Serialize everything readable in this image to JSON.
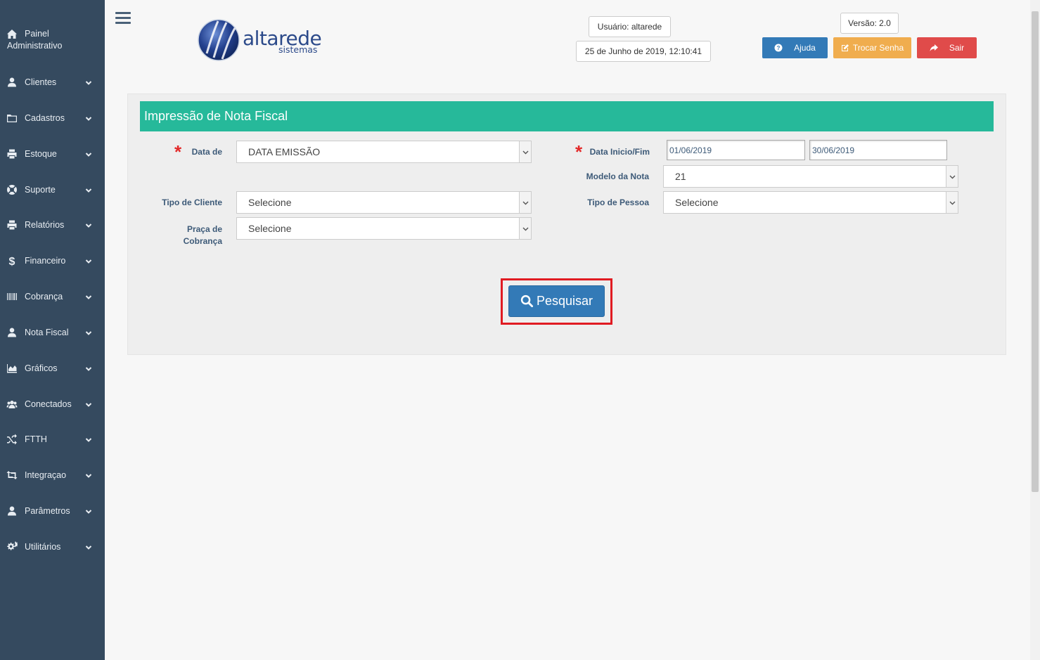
{
  "sidebar": {
    "painel_line1": "Painel",
    "painel_line2": "Administrativo",
    "items": [
      {
        "label": "Clientes",
        "icon": "user-icon"
      },
      {
        "label": "Cadastros",
        "icon": "folder-icon"
      },
      {
        "label": "Estoque",
        "icon": "print-icon"
      },
      {
        "label": "Suporte",
        "icon": "lifebuoy-icon"
      },
      {
        "label": "Relatórios",
        "icon": "print-icon"
      },
      {
        "label": "Financeiro",
        "icon": "dollar-icon"
      },
      {
        "label": "Cobrança",
        "icon": "barcode-icon"
      },
      {
        "label": "Nota Fiscal",
        "icon": "user-icon"
      },
      {
        "label": "Gráficos",
        "icon": "area-chart-icon"
      },
      {
        "label": "Conectados",
        "icon": "users-icon"
      },
      {
        "label": "FTTH",
        "icon": "random-icon"
      },
      {
        "label": "Integraçao",
        "icon": "retweet-icon"
      },
      {
        "label": "Parâmetros",
        "icon": "user-icon"
      },
      {
        "label": "Utilitários",
        "icon": "cogs-icon"
      }
    ]
  },
  "header": {
    "logo_text": "altarede",
    "logo_sub": "sistemas",
    "usuario": "Usuário: altarede",
    "datetime": "25 de Junho de 2019, 12:10:41",
    "versao": "Versão: 2.0",
    "btn_ajuda": "Ajuda",
    "btn_trocar_senha": "Trocar Senha",
    "btn_sair": "Sair"
  },
  "form": {
    "title": "Impressão de Nota Fiscal",
    "required_mark": "*",
    "data_de_label": "Data de",
    "data_de_value": "DATA EMISSÃO",
    "data_inicio_fim_label": "Data Inicio/Fim",
    "data_inicio_value": "01/06/2019",
    "data_fim_value": "30/06/2019",
    "modelo_nota_label": "Modelo da Nota",
    "modelo_nota_value": "21",
    "tipo_cliente_label": "Tipo de Cliente",
    "tipo_cliente_value": "Selecione",
    "tipo_pessoa_label": "Tipo de Pessoa",
    "tipo_pessoa_value": "Selecione",
    "praca_label_line1": "Praça de",
    "praca_label_line2": "Cobrança",
    "praca_value": "Selecione",
    "search_button": "Pesquisar"
  },
  "colors": {
    "sidebar_bg": "#354a5f",
    "panel_header": "#26b99a",
    "primary": "#337ab7",
    "warning": "#f0ad4e",
    "danger": "#e04b4a",
    "highlight": "#e01b22"
  }
}
